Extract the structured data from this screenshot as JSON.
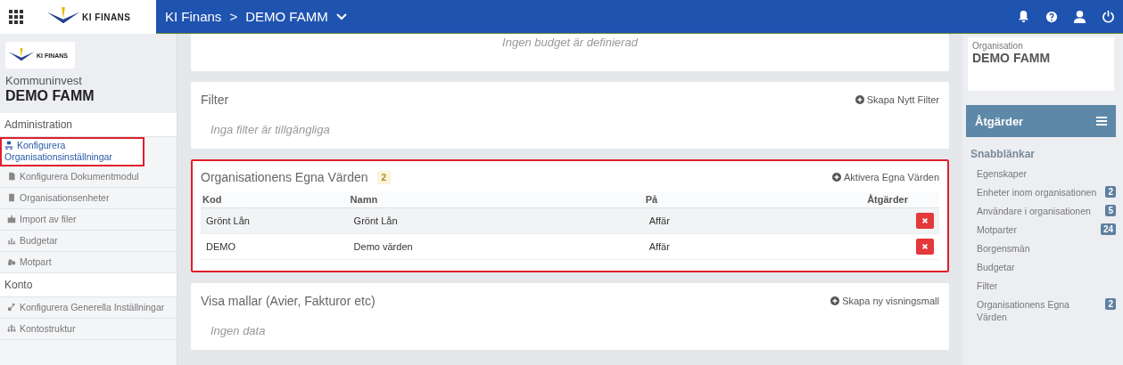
{
  "topbar": {
    "logo_text": "KI FINANS",
    "breadcrumb": [
      "KI Finans",
      "DEMO FAMM"
    ],
    "separator": ">"
  },
  "sidebar": {
    "logo_text": "KI FINANS",
    "org_parent": "Kommuninvest",
    "org_name": "DEMO FAMM",
    "sections": [
      {
        "title": "Administration",
        "items": [
          {
            "label": "Konfigurera Organisationsinställningar",
            "selected": true,
            "highlighted": true
          },
          {
            "label": "Konfigurera Dokumentmodul",
            "selected": false,
            "highlighted": false
          },
          {
            "label": "Organisationsenheter",
            "selected": false,
            "highlighted": false
          },
          {
            "label": "Import av filer",
            "selected": false,
            "highlighted": false
          },
          {
            "label": "Budgetar",
            "selected": false,
            "highlighted": false
          },
          {
            "label": "Motpart",
            "selected": false,
            "highlighted": false
          }
        ]
      },
      {
        "title": "Konto",
        "items": [
          {
            "label": "Konfigurera Generella Inställningar",
            "selected": false,
            "highlighted": false
          },
          {
            "label": "Kontostruktur",
            "selected": false,
            "highlighted": false
          }
        ]
      }
    ]
  },
  "cards": [
    {
      "kind": "empty",
      "empty_text": "Ingen budget är definierad",
      "highlighted": false
    },
    {
      "kind": "list",
      "title": "Filter",
      "action": "Skapa Nytt Filter",
      "empty_text": "Inga filter är tillgängliga",
      "highlighted": false
    },
    {
      "kind": "table",
      "title": "Organisationens Egna Värden",
      "count": "2",
      "action": "Aktivera Egna Värden",
      "highlighted": true,
      "columns": [
        "Kod",
        "Namn",
        "På",
        "Åtgärder"
      ],
      "rows": [
        [
          "Grönt Lån",
          "Grönt Lån",
          "Affär"
        ],
        [
          "DEMO",
          "Demo värden",
          "Affär"
        ]
      ]
    },
    {
      "kind": "list",
      "title": "Visa mallar (Avier, Fakturor etc)",
      "action": "Skapa ny visningsmall",
      "empty_text": "Ingen data",
      "highlighted": false
    }
  ],
  "right": {
    "org_label": "Organisation",
    "org_name": "DEMO FAMM",
    "actions_title": "Åtgärder",
    "links_title": "Snabblänkar",
    "links": [
      {
        "label": "Egenskaper"
      },
      {
        "label": "Enheter inom organisationen",
        "count": "2"
      },
      {
        "label": "Användare i organisationen",
        "count": "5"
      },
      {
        "label": "Motparter",
        "count": "24"
      },
      {
        "label": "Borgensmän"
      },
      {
        "label": "Budgetar"
      },
      {
        "label": "Filter"
      },
      {
        "label": "Organisationens Egna Värden",
        "count": "2"
      }
    ]
  }
}
